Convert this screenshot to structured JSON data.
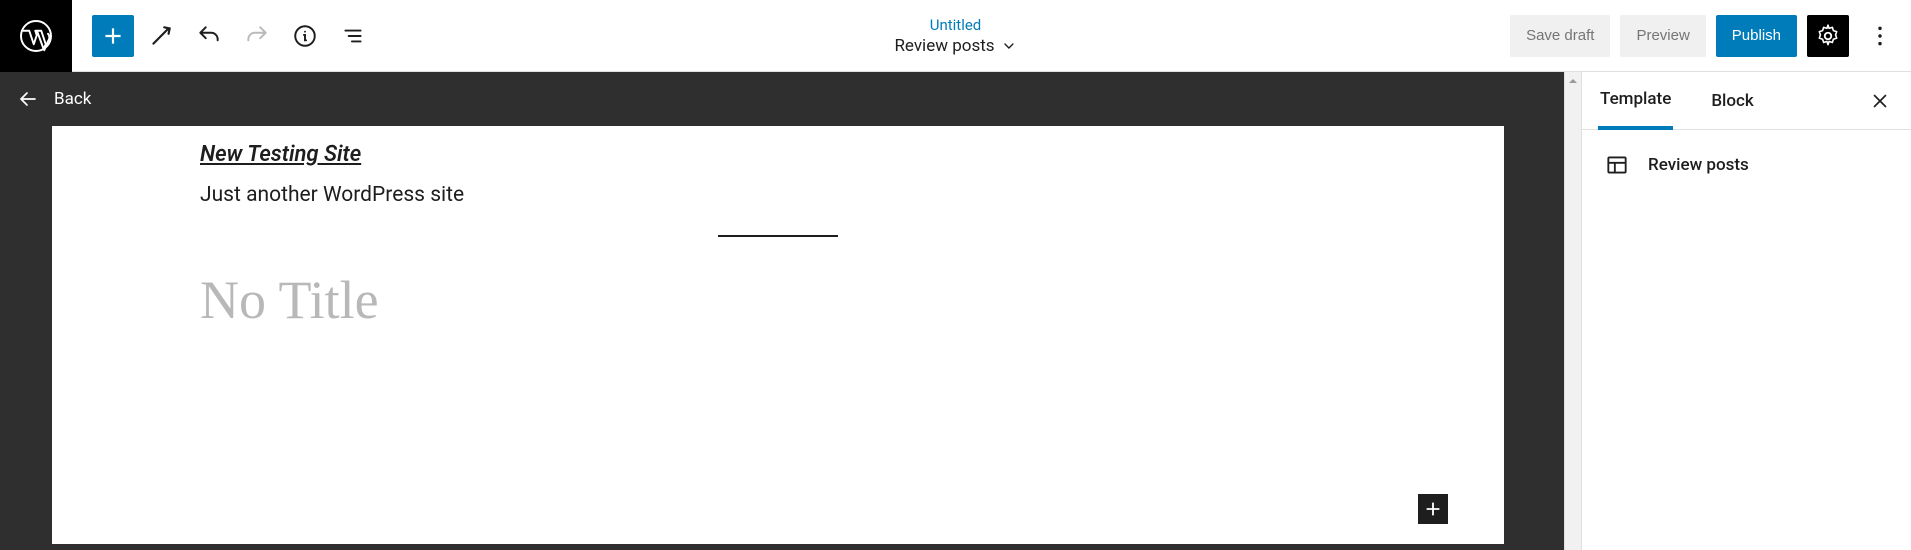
{
  "toolbar": {
    "document_title": "Untitled",
    "document_type": "Review posts",
    "save_draft": "Save draft",
    "preview": "Preview",
    "publish": "Publish"
  },
  "editor": {
    "back_label": "Back",
    "site_title": "New Testing Site",
    "tagline": "Just another WordPress site",
    "post_title_placeholder": "No Title"
  },
  "sidebar": {
    "tabs": {
      "template": "Template",
      "block": "Block"
    },
    "template_name": "Review posts"
  }
}
